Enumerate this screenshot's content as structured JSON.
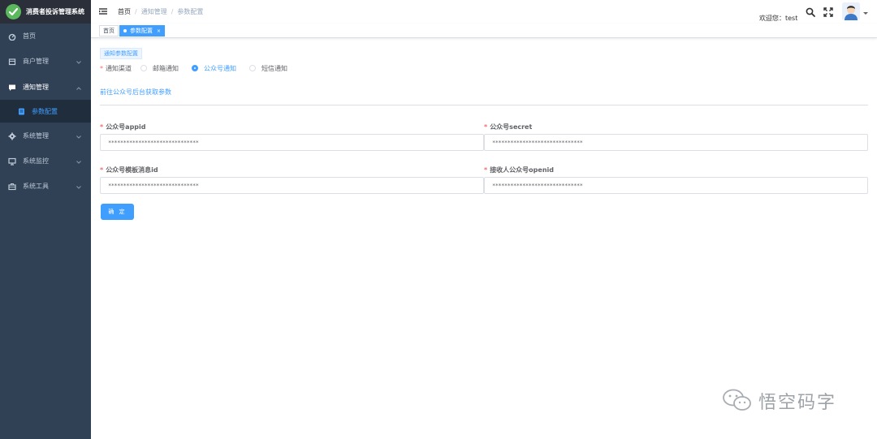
{
  "app": {
    "title": "消费者投诉管理系统"
  },
  "sidebar": {
    "items": [
      {
        "label": "首页",
        "icon": "dashboard-icon"
      },
      {
        "label": "商户管理",
        "icon": "shop-icon"
      },
      {
        "label": "通知管理",
        "icon": "message-icon",
        "expanded": true,
        "children": [
          {
            "label": "参数配置",
            "icon": "document-icon",
            "active": true
          }
        ]
      },
      {
        "label": "系统管理",
        "icon": "gear-icon"
      },
      {
        "label": "系统监控",
        "icon": "monitor-icon"
      },
      {
        "label": "系统工具",
        "icon": "toolbox-icon"
      }
    ]
  },
  "header": {
    "breadcrumb": [
      "首页",
      "通知管理",
      "参数配置"
    ],
    "welcome": "欢迎您：test"
  },
  "tags": [
    {
      "label": "首页",
      "active": false
    },
    {
      "label": "参数配置",
      "active": true
    }
  ],
  "form": {
    "section_tag": "通知参数配置",
    "channel_label": "通知渠道",
    "channels": [
      {
        "label": "邮箱通知",
        "checked": false
      },
      {
        "label": "公众号通知",
        "checked": true
      },
      {
        "label": "短信通知",
        "checked": false
      }
    ],
    "link_text": "前往公众号后台获取参数",
    "fields": [
      {
        "label": "公众号appid",
        "value": "******************************"
      },
      {
        "label": "公众号secret",
        "value": "******************************"
      },
      {
        "label": "公众号模板消息id",
        "value": "******************************"
      },
      {
        "label": "接收人公众号openid",
        "value": "******************************"
      }
    ],
    "submit_label": "确 定"
  },
  "watermark": {
    "text": "悟空码字"
  },
  "colors": {
    "primary": "#409eff",
    "sidebar_bg": "#304156",
    "required": "#f56c6c",
    "logo_green": "#5cb85c"
  }
}
